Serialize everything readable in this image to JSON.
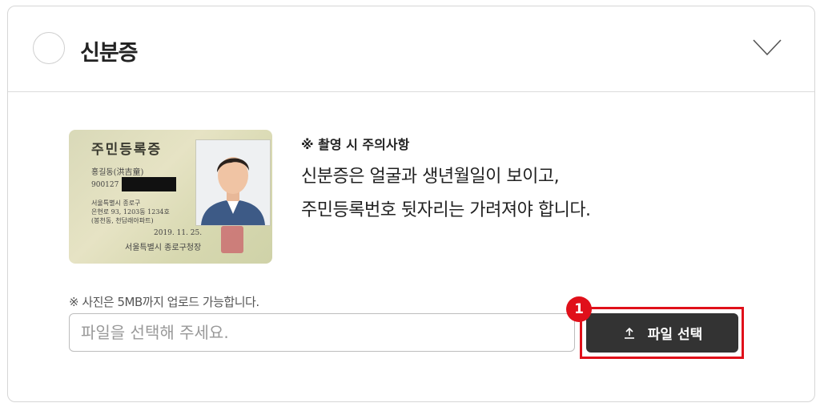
{
  "section": {
    "title": "신분증"
  },
  "id_card": {
    "card_title": "주민등록증",
    "name": "홍길동(洪吉童)",
    "number_prefix": "900127",
    "address_line1": "서울특별시 종로구",
    "address_line2": "은현로 93, 1203동 1234호",
    "address_line3": "(봉천동, 천답래아파트)",
    "issue_date": "2019. 11. 25.",
    "issuer": "서울특별시 종로구청장"
  },
  "notice": {
    "heading": "※ 촬영 시 주의사항",
    "line1": "신분증은 얼굴과 생년월일이 보이고,",
    "line2": "주민등록번호 뒷자리는 가려져야 합니다."
  },
  "upload": {
    "note": "※ 사진은 5MB까지 업로드 가능합니다.",
    "placeholder": "파일을 선택해 주세요.",
    "button_label": "파일 선택",
    "step_number": "1"
  },
  "colors": {
    "button_bg": "#333333",
    "highlight": "#e0101a"
  }
}
